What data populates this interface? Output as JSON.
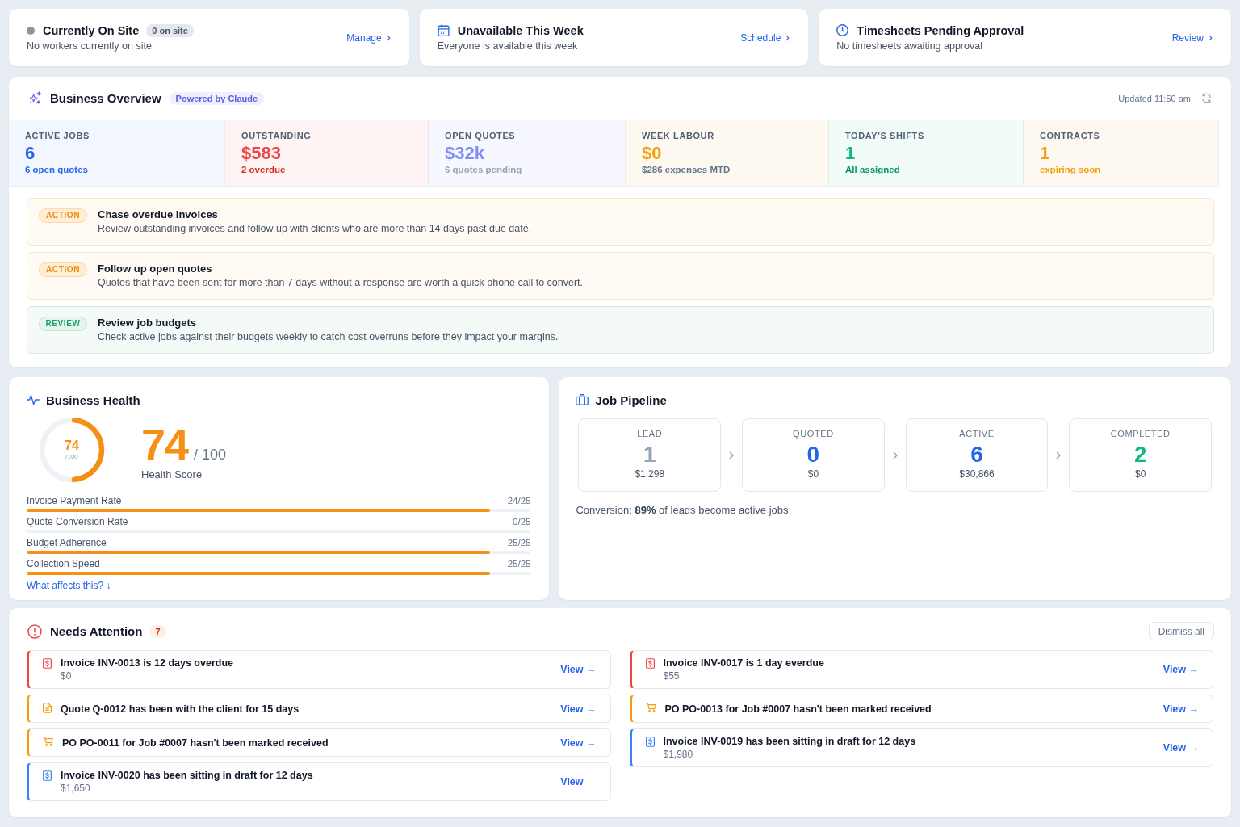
{
  "top_cards": [
    {
      "kind": "status",
      "title": "Currently On Site",
      "badge": "0 on site",
      "subtitle": "No workers currently on site",
      "link": "Manage"
    },
    {
      "kind": "calendar",
      "title": "Unavailable This Week",
      "subtitle": "Everyone is available this week",
      "link": "Schedule"
    },
    {
      "kind": "clock",
      "title": "Timesheets Pending Approval",
      "subtitle": "No timesheets awaiting approval",
      "link": "Review"
    }
  ],
  "overview": {
    "title": "Business Overview",
    "badge": "Powered by Claude",
    "updated": "Updated 11:50 am",
    "stats": [
      {
        "label": "ACTIVE JOBS",
        "value": "6",
        "color": "#2563eb",
        "note": {
          "text": "6 open quotes",
          "color": "#2563eb"
        }
      },
      {
        "label": "OUTSTANDING",
        "value": "$583",
        "color": "#ef4444",
        "note": {
          "text": "2 overdue",
          "color": "#dc2626"
        }
      },
      {
        "label": "OPEN QUOTES",
        "value": "$32k",
        "color": "#818cf8",
        "note": {
          "text": "6 quotes pending",
          "color": "#94a3b8"
        }
      },
      {
        "label": "WEEK LABOUR",
        "value": "$0",
        "color": "#f59e0b",
        "note": {
          "text": "$286 expenses MTD",
          "color": "#64748b"
        }
      },
      {
        "label": "TODAY'S SHIFTS",
        "value": "1",
        "color": "#10b981",
        "note": {
          "text": "All assigned",
          "color": "#059669"
        }
      },
      {
        "label": "CONTRACTS",
        "value": "1",
        "color": "#f59e0b",
        "note": {
          "text": "expiring soon",
          "color": "#f59e0b"
        }
      }
    ],
    "insights": [
      {
        "kind": "action",
        "badge": "ACTION",
        "title": "Chase overdue invoices",
        "text": "Review outstanding invoices and follow up with clients who are more than 14 days past due date."
      },
      {
        "kind": "action",
        "badge": "ACTION",
        "title": "Follow up open quotes",
        "text": "Quotes that have been sent for more than 7 days without a response are worth a quick phone call to convert."
      },
      {
        "kind": "review",
        "badge": "REVIEW",
        "title": "Review job budgets",
        "text": "Check active jobs against their budgets weekly to catch cost overruns before they impact your margins."
      }
    ]
  },
  "health": {
    "title": "Business Health",
    "level": 0.5,
    "gauge_value": "74",
    "gauge_max": "/100",
    "score": "74",
    "score_max": "/ 100",
    "caption": "Health Score",
    "metrics": [
      {
        "label": "Invoice Payment Rate",
        "value": "24/25",
        "level": 0.92
      },
      {
        "label": "Quote Conversion Rate",
        "value": "0/25"
      },
      {
        "label": "Budget Adherence",
        "value": "25/25",
        "level": 0.92
      },
      {
        "label": "Collection Speed",
        "value": "25/25",
        "level": 0.92
      }
    ],
    "link": "What affects this? ↓"
  },
  "pipeline": {
    "title": "Job Pipeline",
    "stages": [
      {
        "label": "LEAD",
        "count": "1",
        "amount": "$1,298",
        "color": "#94a3b8"
      },
      {
        "label": "QUOTED",
        "count": "0",
        "amount": "$0",
        "color": "#2563eb"
      },
      {
        "label": "ACTIVE",
        "count": "6",
        "amount": "$30,866",
        "color": "#2563eb"
      },
      {
        "label": "COMPLETED",
        "count": "2",
        "amount": "$0",
        "color": "#10b981"
      }
    ],
    "conversion": "Conversion: **89%** of leads become active jobs"
  },
  "attention": {
    "title": "Needs Attention",
    "count": "7",
    "dismiss": "Dismiss all",
    "columns": [
      {
        "items": [
          {
            "kind": "invoice",
            "color": "#ef4444",
            "title": "Invoice INV-0013 is 12 days overdue",
            "amount": "$0",
            "link": "View →"
          },
          {
            "kind": "quote",
            "color": "#f59e0b",
            "title": "Quote Q-0012 has been with the client for 15 days",
            "link": "View →"
          },
          {
            "kind": "po",
            "color": "#f59e0b",
            "title": "PO PO-0011 for Job #0007 hasn't been marked received",
            "link": "View →"
          },
          {
            "kind": "invoice",
            "color": "#3b82f6",
            "title": "Invoice INV-0020 has been sitting in draft for 12 days",
            "amount": "$1,650",
            "link": "View →"
          }
        ]
      },
      {
        "items": [
          {
            "kind": "invoice",
            "color": "#ef4444",
            "title": "Invoice INV-0017 is 1 day everdue",
            "amount": "$55",
            "link": "View →"
          },
          {
            "kind": "po",
            "color": "#f59e0b",
            "title": "PO PO-0013 for Job #0007 hasn't been marked received",
            "link": "View →"
          },
          {
            "kind": "invoice",
            "color": "#3b82f6",
            "title": "Invoice INV-0019 has been sitting in draft for 12 days",
            "amount": "$1,980",
            "link": "View →"
          }
        ]
      }
    ]
  }
}
